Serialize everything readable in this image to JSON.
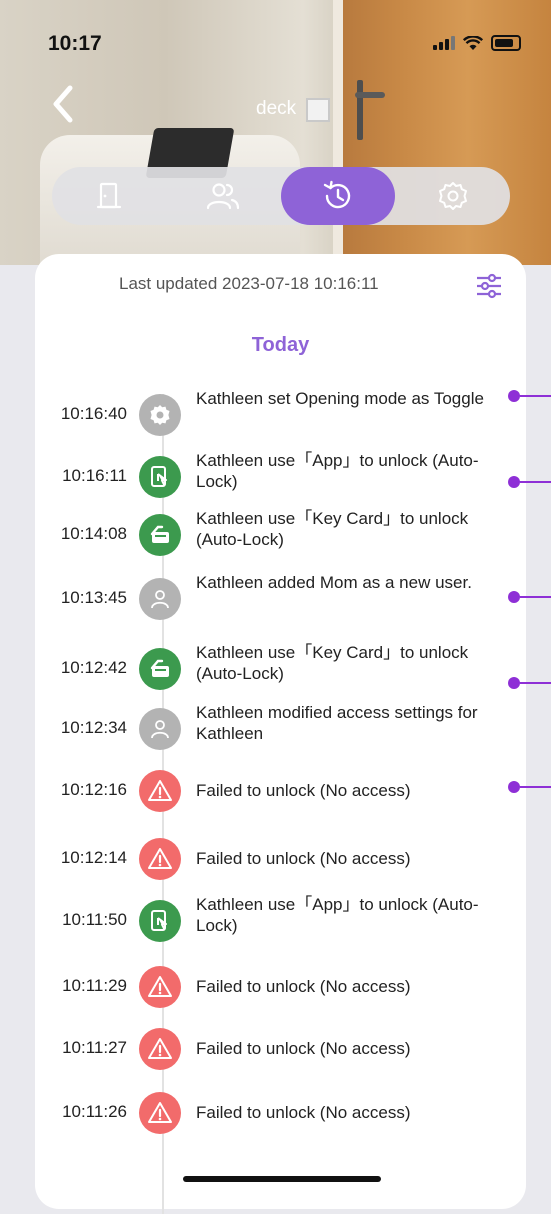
{
  "status": {
    "time": "10:17"
  },
  "header": {
    "title": "deck"
  },
  "tabs": [
    {
      "name": "door",
      "active": false
    },
    {
      "name": "users",
      "active": false
    },
    {
      "name": "history",
      "active": true
    },
    {
      "name": "settings",
      "active": false
    }
  ],
  "card": {
    "last_updated": "Last updated 2023-07-18 10:16:11",
    "section_title": "Today"
  },
  "colors": {
    "accent": "#8e63d7",
    "green": "#3c9a4e",
    "red": "#f26b6b",
    "gray": "#b3b3b3"
  },
  "events": [
    {
      "time": "10:16:40",
      "icon": "gear-icon",
      "type": "gray",
      "text": "Kathleen  set Opening mode as Toggle"
    },
    {
      "time": "10:16:11",
      "icon": "app-unlock-icon",
      "type": "green",
      "text": "Kathleen use「App」to unlock (Auto-Lock)"
    },
    {
      "time": "10:14:08",
      "icon": "key-card-icon",
      "type": "green",
      "text": "Kathleen use「Key Card」to unlock (Auto-Lock)"
    },
    {
      "time": "10:13:45",
      "icon": "user-icon",
      "type": "gray",
      "text": "Kathleen  added Mom as a new user."
    },
    {
      "time": "10:12:42",
      "icon": "key-card-icon",
      "type": "green",
      "text": "Kathleen use「Key Card」to unlock (Auto-Lock)"
    },
    {
      "time": "10:12:34",
      "icon": "user-icon",
      "type": "gray",
      "text": "Kathleen  modified access settings for Kathleen"
    },
    {
      "time": "10:12:16",
      "icon": "warning-icon",
      "type": "red",
      "text": "Failed to unlock (No access)"
    },
    {
      "time": "10:12:14",
      "icon": "warning-icon",
      "type": "red",
      "text": "Failed to unlock (No access)"
    },
    {
      "time": "10:11:50",
      "icon": "app-unlock-icon",
      "type": "green",
      "text": "Kathleen use「App」to unlock (Auto-Lock)"
    },
    {
      "time": "10:11:29",
      "icon": "warning-icon",
      "type": "red",
      "text": "Failed to unlock (No access)"
    },
    {
      "time": "10:11:27",
      "icon": "warning-icon",
      "type": "red",
      "text": "Failed to unlock (No access)"
    },
    {
      "time": "10:11:26",
      "icon": "warning-icon",
      "type": "red",
      "text": "Failed to unlock (No access)"
    }
  ]
}
